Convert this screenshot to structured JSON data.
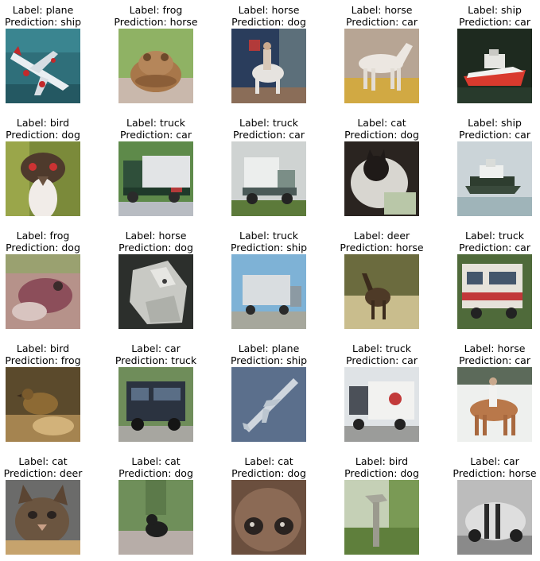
{
  "grid": [
    {
      "label": "Label: plane",
      "prediction": "Prediction: ship",
      "image": "airplane"
    },
    {
      "label": "Label: frog",
      "prediction": "Prediction: horse",
      "image": "frog"
    },
    {
      "label": "Label: horse",
      "prediction": "Prediction: dog",
      "image": "horse-rider"
    },
    {
      "label": "Label: horse",
      "prediction": "Prediction: car",
      "image": "horse"
    },
    {
      "label": "Label: ship",
      "prediction": "Prediction: car",
      "image": "boat"
    },
    {
      "label": "Label: bird",
      "prediction": "Prediction: dog",
      "image": "ostrich"
    },
    {
      "label": "Label: truck",
      "prediction": "Prediction: car",
      "image": "truck"
    },
    {
      "label": "Label: truck",
      "prediction": "Prediction: car",
      "image": "truck"
    },
    {
      "label": "Label: cat",
      "prediction": "Prediction: dog",
      "image": "cat"
    },
    {
      "label": "Label: ship",
      "prediction": "Prediction: car",
      "image": "boat"
    },
    {
      "label": "Label: frog",
      "prediction": "Prediction: dog",
      "image": "frog"
    },
    {
      "label": "Label: horse",
      "prediction": "Prediction: dog",
      "image": "horse-statue"
    },
    {
      "label": "Label: truck",
      "prediction": "Prediction: ship",
      "image": "truck"
    },
    {
      "label": "Label: deer",
      "prediction": "Prediction: horse",
      "image": "deer"
    },
    {
      "label": "Label: truck",
      "prediction": "Prediction: car",
      "image": "truck"
    },
    {
      "label": "Label: bird",
      "prediction": "Prediction: frog",
      "image": "bird"
    },
    {
      "label": "Label: car",
      "prediction": "Prediction: truck",
      "image": "van"
    },
    {
      "label": "Label: plane",
      "prediction": "Prediction: ship",
      "image": "airplane"
    },
    {
      "label": "Label: truck",
      "prediction": "Prediction: car",
      "image": "truck"
    },
    {
      "label": "Label: horse",
      "prediction": "Prediction: car",
      "image": "horse-rider"
    },
    {
      "label": "Label: cat",
      "prediction": "Prediction: deer",
      "image": "cat"
    },
    {
      "label": "Label: cat",
      "prediction": "Prediction: dog",
      "image": "cat"
    },
    {
      "label": "Label: cat",
      "prediction": "Prediction: dog",
      "image": "cat-face"
    },
    {
      "label": "Label: bird",
      "prediction": "Prediction: dog",
      "image": "bird"
    },
    {
      "label": "Label: car",
      "prediction": "Prediction: horse",
      "image": "car"
    }
  ]
}
